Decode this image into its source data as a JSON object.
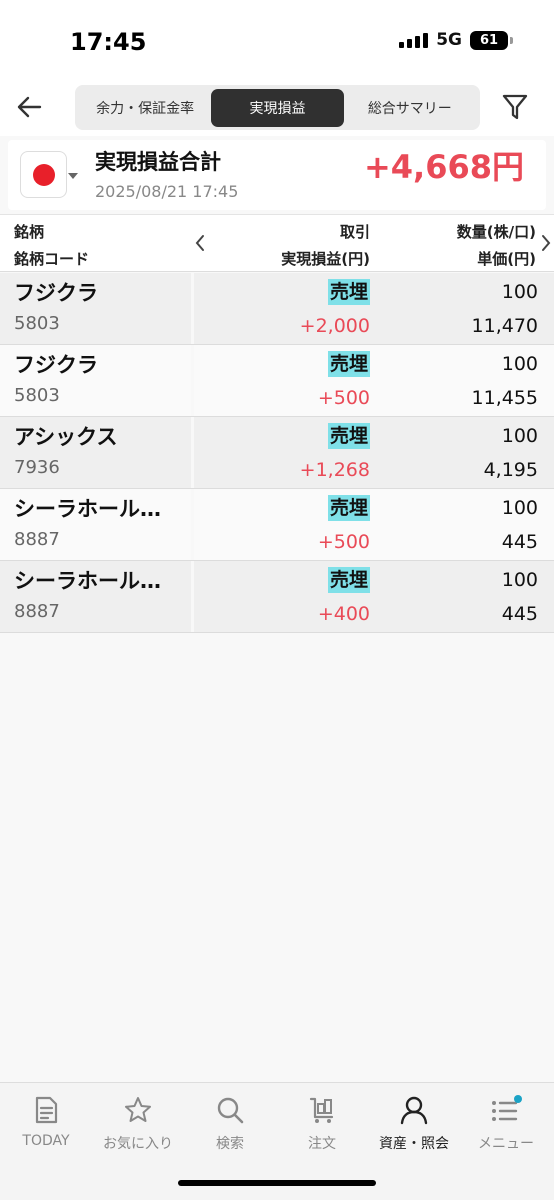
{
  "status_bar": {
    "time": "17:45",
    "network": "5G",
    "battery": "61"
  },
  "header": {
    "tabs": [
      {
        "label": "余力・保証金率",
        "active": false
      },
      {
        "label": "実現損益",
        "active": true
      },
      {
        "label": "総合サマリー",
        "active": false
      }
    ],
    "icons": {
      "back": "back-arrow-icon",
      "filter": "filter-icon"
    }
  },
  "summary": {
    "title": "実現損益合計",
    "date": "2025/08/21 17:45",
    "value": "+4,668円",
    "market_flag": "japan-flag-icon"
  },
  "table_header": {
    "col1_line1": "銘柄",
    "col1_line2": "銘柄コード",
    "col2_line1": "取引",
    "col2_line2": "実現損益(円)",
    "col3_line1": "数量(株/口)",
    "col3_line2": "単価(円)"
  },
  "rows": [
    {
      "name": "フジクラ",
      "code": "5803",
      "trade": "売埋",
      "pnl": "+2,000",
      "qty": "100",
      "price": "11,470"
    },
    {
      "name": "フジクラ",
      "code": "5803",
      "trade": "売埋",
      "pnl": "+500",
      "qty": "100",
      "price": "11,455"
    },
    {
      "name": "アシックス",
      "code": "7936",
      "trade": "売埋",
      "pnl": "+1,268",
      "qty": "100",
      "price": "4,195"
    },
    {
      "name": "シーラホール…",
      "code": "8887",
      "trade": "売埋",
      "pnl": "+500",
      "qty": "100",
      "price": "445"
    },
    {
      "name": "シーラホール…",
      "code": "8887",
      "trade": "売埋",
      "pnl": "+400",
      "qty": "100",
      "price": "445"
    }
  ],
  "bottom_nav": {
    "items": [
      {
        "label": "TODAY",
        "icon": "document-icon",
        "active": false
      },
      {
        "label": "お気に入り",
        "icon": "star-icon",
        "active": false
      },
      {
        "label": "検索",
        "icon": "search-icon",
        "active": false
      },
      {
        "label": "注文",
        "icon": "cart-icon",
        "active": false
      },
      {
        "label": "資産・照会",
        "icon": "person-icon",
        "active": true
      },
      {
        "label": "メニュー",
        "icon": "menu-list-icon",
        "active": false
      }
    ]
  },
  "colors": {
    "profit": "#e94a57",
    "trade_highlight": "#7fe0e8",
    "active_tab": "#303030",
    "notification_dot": "#1ba3c6"
  }
}
